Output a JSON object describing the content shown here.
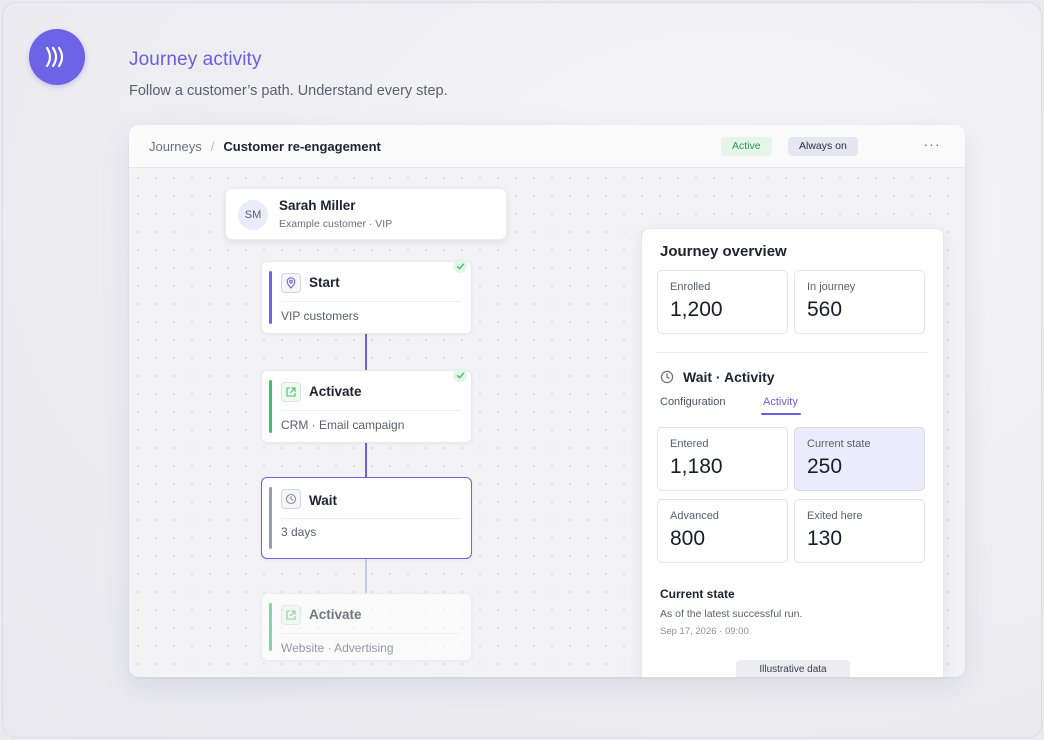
{
  "header": {
    "title": "Journey activity",
    "subtitle": "Follow a customer’s path. Understand every step."
  },
  "breadcrumb": {
    "root": "Journeys",
    "separator": "/",
    "current": "Customer re-engagement"
  },
  "badges": {
    "status": "Active",
    "mode": "Always on"
  },
  "more_label": "···",
  "customer": {
    "initials": "SM",
    "name": "Sarah Miller",
    "subtitle": "Example customer · VIP"
  },
  "steps": [
    {
      "title": "Start",
      "subtitle": "VIP customers",
      "icon": "location-pin-icon",
      "completed": true,
      "accent": "#6b63e6"
    },
    {
      "title": "Activate",
      "subtitle": "CRM · Email campaign",
      "icon": "external-link-icon",
      "completed": true,
      "accent": "#3fbf6d"
    },
    {
      "title": "Wait",
      "subtitle": "3 days",
      "icon": "clock-icon",
      "completed": false,
      "selected": true,
      "accent": "#9a9db0"
    },
    {
      "title": "Activate",
      "subtitle": "Website · Advertising",
      "icon": "external-link-icon",
      "completed": false,
      "faded": true,
      "accent": "#3fbf6d"
    }
  ],
  "overview": {
    "title": "Journey overview",
    "enrolled_label": "Enrolled",
    "enrolled_value": "1,200",
    "in_journey_label": "In journey",
    "in_journey_value": "560"
  },
  "selected_step": {
    "title": "Wait · Activity",
    "tabs": [
      "Configuration",
      "Activity"
    ],
    "active_tab": "Activity",
    "stats": [
      {
        "label": "Entered",
        "value": "1,180"
      },
      {
        "label": "Current state",
        "value": "250",
        "highlighted": true
      },
      {
        "label": "Advanced",
        "value": "800"
      },
      {
        "label": "Exited here",
        "value": "130"
      }
    ],
    "current_state_title": "Current state",
    "current_state_desc": "As of the latest successful run.",
    "current_state_time": "Sep 17, 2026 · 09:00",
    "illustrative_label": "Illustrative data"
  },
  "colors": {
    "brand": "#6c63e6",
    "success": "#3fbf6d",
    "highlight_bg": "#ecebfb"
  }
}
